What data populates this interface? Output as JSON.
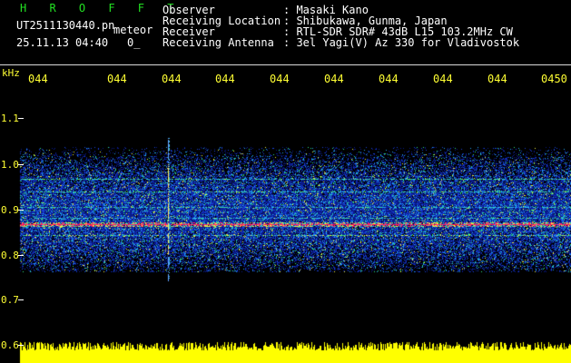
{
  "header": {
    "app_title": "H R O F F T",
    "filename": "UT2511130440.pn",
    "meteor_label": "meteor",
    "datetime": "25.11.13 04:40",
    "count": "0_"
  },
  "station_info": [
    {
      "label": "Observer",
      "value": ": Masaki Kano"
    },
    {
      "label": "Receiving Location",
      "value": ": Shibukawa, Gunma, Japan"
    },
    {
      "label": "Receiver",
      "value": ": RTL-SDR SDR# 43dB L15 103.2MHz CW"
    },
    {
      "label": "Receiving Antenna",
      "value": ": 3el Yagi(V) Az 330 for Vladivostok"
    }
  ],
  "axis": {
    "unit": "kHz",
    "freq_labels": [
      "1.1",
      "1.0",
      "0.9",
      "0.8",
      "0.7",
      "0.6"
    ],
    "time_labels": [
      "044",
      "044",
      "044",
      "044",
      "044",
      "044",
      "044",
      "044",
      "044",
      "0450"
    ]
  },
  "colors": {
    "background": "#000000",
    "label_yellow": "#ffff33",
    "title_green": "#22e022",
    "carrier_red": "#ff2060",
    "noise_blue": "#1030c0",
    "signal_yellow": "#ffff00"
  }
}
